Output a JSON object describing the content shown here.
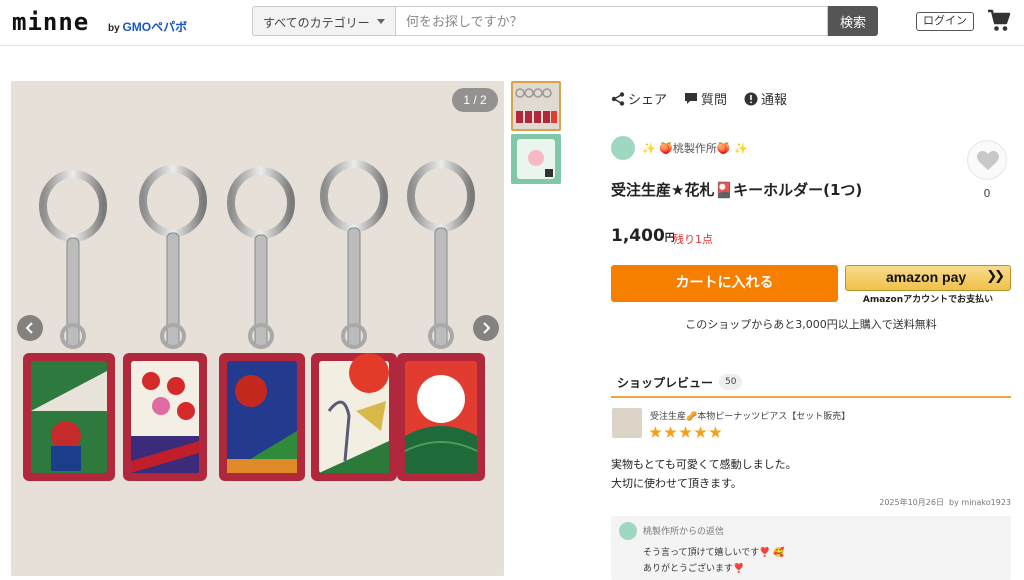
{
  "header": {
    "logo": "minne",
    "logo_by": "by",
    "logo_brand": "GMOペパボ",
    "category_select": "すべてのカテゴリー",
    "search_placeholder": "何をお探しですか？",
    "search_button": "検索",
    "login_button": "ログイン",
    "cart_icon": "cart-icon"
  },
  "gallery": {
    "counter": "1 / 2",
    "prev_icon": "chevron-left-icon",
    "next_icon": "chevron-right-icon",
    "thumbnail_count": 2
  },
  "actions": {
    "share": "シェア",
    "question": "質問",
    "report": "通報"
  },
  "shop": {
    "name": "✨ 🍑桃製作所🍑 ✨"
  },
  "favorite": {
    "icon": "heart-icon",
    "count": "0"
  },
  "product": {
    "title": "受注生産★花札🎴キーホルダー(1つ)",
    "price": "1,400",
    "price_unit": "円",
    "stock": "残り1点"
  },
  "purchase": {
    "cart_button": "カートに入れる",
    "amazon_pay": "amazon pay",
    "amazon_caption": "Amazonアカウントでお支払い",
    "shipping_note": "このショップからあと3,000円以上購入で送料無料"
  },
  "reviews": {
    "tab_label": "ショップレビュー",
    "count": "50",
    "item_title": "受注生産🥜本物ピーナッツピアス【セット販売】",
    "rating": 5,
    "text_line1": "実物もとても可愛くて感動しました。",
    "text_line2": "大切に使わせて頂きます。",
    "date": "2025年10月26日",
    "author": "by minako1923",
    "reply_from": "桃製作所からの返信",
    "reply_line1": "そう言って頂けて嬉しいです❣️ 🥰",
    "reply_line2": "ありがとうございます❣️"
  },
  "colors": {
    "accent_orange": "#f77f00",
    "review_tab_rule": "#f0a43a",
    "stock_red": "#dd3333",
    "star": "#f5a01a"
  }
}
